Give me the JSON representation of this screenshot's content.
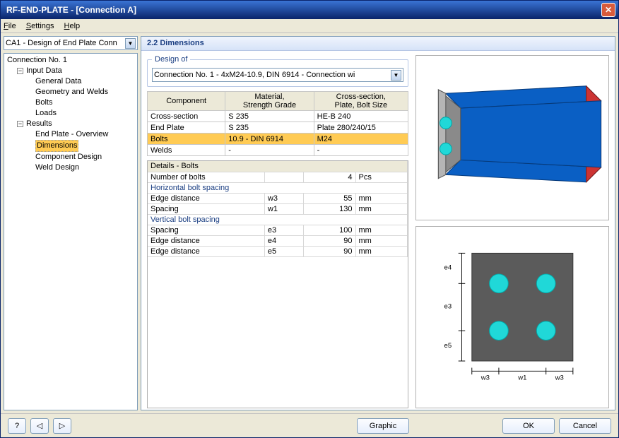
{
  "window": {
    "title": "RF-END-PLATE - [Connection A]"
  },
  "menu": {
    "file": "File",
    "settings": "Settings",
    "help": "Help"
  },
  "left": {
    "combo": "CA1 - Design of End Plate Conn",
    "tree": {
      "root": "Connection No. 1",
      "input": "Input Data",
      "general": "General Data",
      "geom": "Geometry and Welds",
      "bolts": "Bolts",
      "loads": "Loads",
      "results": "Results",
      "overview": "End Plate - Overview",
      "dimensions": "Dimensions",
      "compdesign": "Component Design",
      "welddesign": "Weld Design"
    }
  },
  "panel": {
    "title": "2.2 Dimensions",
    "design_of_label": "Design of",
    "design_of_value": "Connection No. 1 - 4xM24-10.9, DIN 6914 - Connection wi"
  },
  "comp_table": {
    "headers": {
      "component": "Component",
      "material": "Material,\nStrength Grade",
      "cross": "Cross-section,\nPlate, Bolt Size"
    },
    "rows": [
      {
        "c": "Cross-section",
        "m": "S 235",
        "x": "HE-B 240"
      },
      {
        "c": "End Plate",
        "m": "S 235",
        "x": "Plate 280/240/15"
      },
      {
        "c": "Bolts",
        "m": "10.9 - DIN 6914",
        "x": "M24",
        "sel": true
      },
      {
        "c": "Welds",
        "m": "-",
        "x": "-"
      }
    ]
  },
  "details": {
    "title": "Details - Bolts",
    "rows": [
      {
        "label": "Number of bolts",
        "sym": "",
        "val": "4",
        "unit": "Pcs"
      },
      {
        "group": "Horizontal bolt spacing"
      },
      {
        "label": "Edge distance",
        "sym": "w3",
        "val": "55",
        "unit": "mm"
      },
      {
        "label": "Spacing",
        "sym": "w1",
        "val": "130",
        "unit": "mm"
      },
      {
        "group": "Vertical bolt spacing"
      },
      {
        "label": "Spacing",
        "sym": "e3",
        "val": "100",
        "unit": "mm"
      },
      {
        "label": "Edge distance",
        "sym": "e4",
        "val": "90",
        "unit": "mm"
      },
      {
        "label": "Edge distance",
        "sym": "e5",
        "val": "90",
        "unit": "mm"
      }
    ]
  },
  "schematic": {
    "e4": "e4",
    "e3": "e3",
    "e5": "e5",
    "w3l": "w3",
    "w1": "w1",
    "w3r": "w3"
  },
  "footer": {
    "help": "?",
    "prev": "◁",
    "next": "▷",
    "graphic": "Graphic",
    "ok": "OK",
    "cancel": "Cancel"
  },
  "colors": {
    "beam_blue": "#0a5fc4",
    "beam_red": "#c33",
    "bolt_cyan": "#20d8d8",
    "plate_gray": "#5b5b5b"
  }
}
